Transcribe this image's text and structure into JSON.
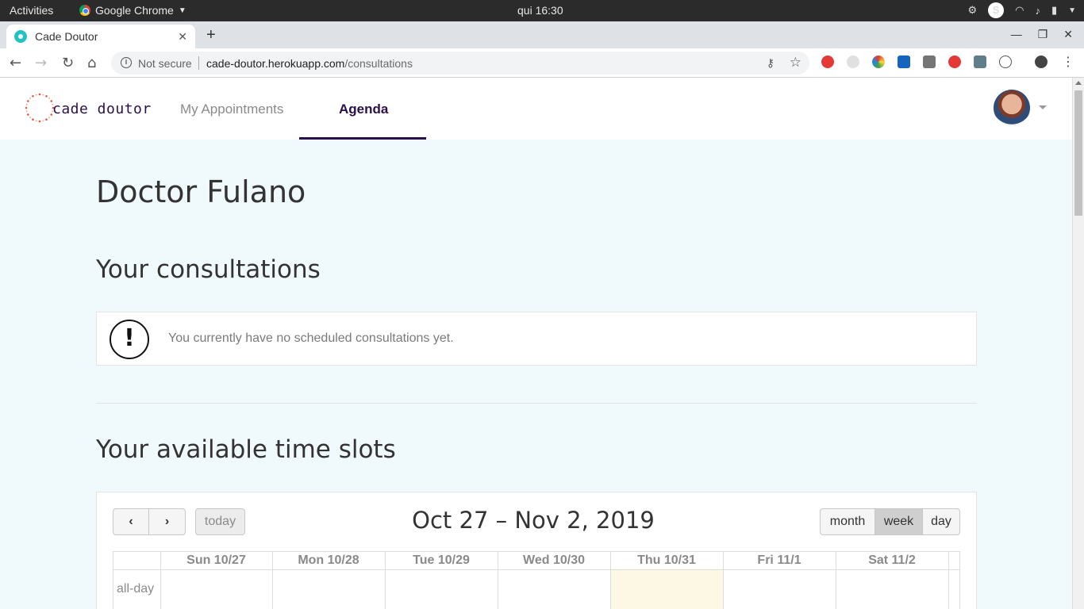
{
  "os_bar": {
    "activities": "Activities",
    "app_name": "Google Chrome",
    "clock": "qui 16:30",
    "skype_label": "S"
  },
  "browser": {
    "tab_title": "Cade Doutor",
    "not_secure": "Not secure",
    "url_host": "cade-doutor.herokuapp.com",
    "url_path": "/consultations"
  },
  "app": {
    "logo_text": "cade doutor",
    "nav": {
      "my_appointments": "My Appointments",
      "agenda": "Agenda"
    }
  },
  "main": {
    "doctor_name": "Doctor Fulano",
    "consultations_title": "Your consultations",
    "no_consultations_text": "You currently have no scheduled consultations yet.",
    "time_slots_title": "Your available time slots"
  },
  "calendar": {
    "prev_label": "‹",
    "next_label": "›",
    "today_label": "today",
    "title": "Oct 27 – Nov 2, 2019",
    "views": {
      "month": "month",
      "week": "week",
      "day": "day"
    },
    "active_view": "week",
    "days": [
      "Sun 10/27",
      "Mon 10/28",
      "Tue 10/29",
      "Wed 10/30",
      "Thu 10/31",
      "Fri 11/1",
      "Sat 11/2"
    ],
    "today_index": 4,
    "allday_label": "all-day"
  },
  "colors": {
    "brand_purple": "#2a0f4a",
    "page_bg": "#f0f9fb",
    "today_highlight": "#fcf8e3"
  }
}
